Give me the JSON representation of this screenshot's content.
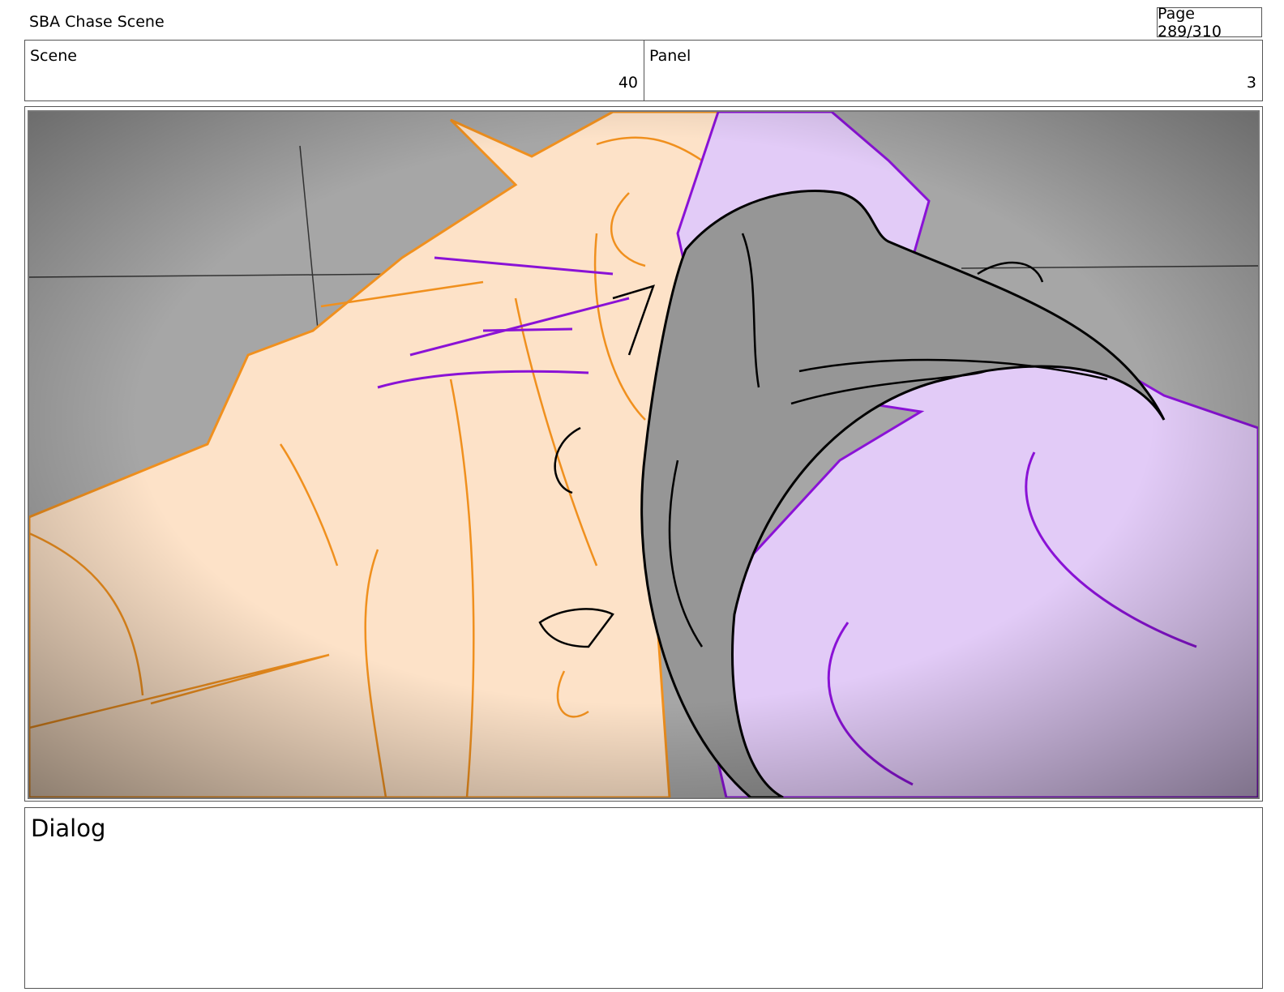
{
  "header": {
    "title": "SBA Chase Scene",
    "page": "Page 289/310"
  },
  "info": {
    "scene_label": "Scene",
    "scene_value": "40",
    "panel_label": "Panel",
    "panel_value": "3"
  },
  "frame": {
    "description_colors": {
      "background": "#a6a6a6",
      "skin": "#fde2c8",
      "skin_line": "#f0901e",
      "purple": "#e2cbf7",
      "purple_line": "#8a12d6",
      "beak": "#969696"
    }
  },
  "dialog": {
    "label": "Dialog"
  }
}
